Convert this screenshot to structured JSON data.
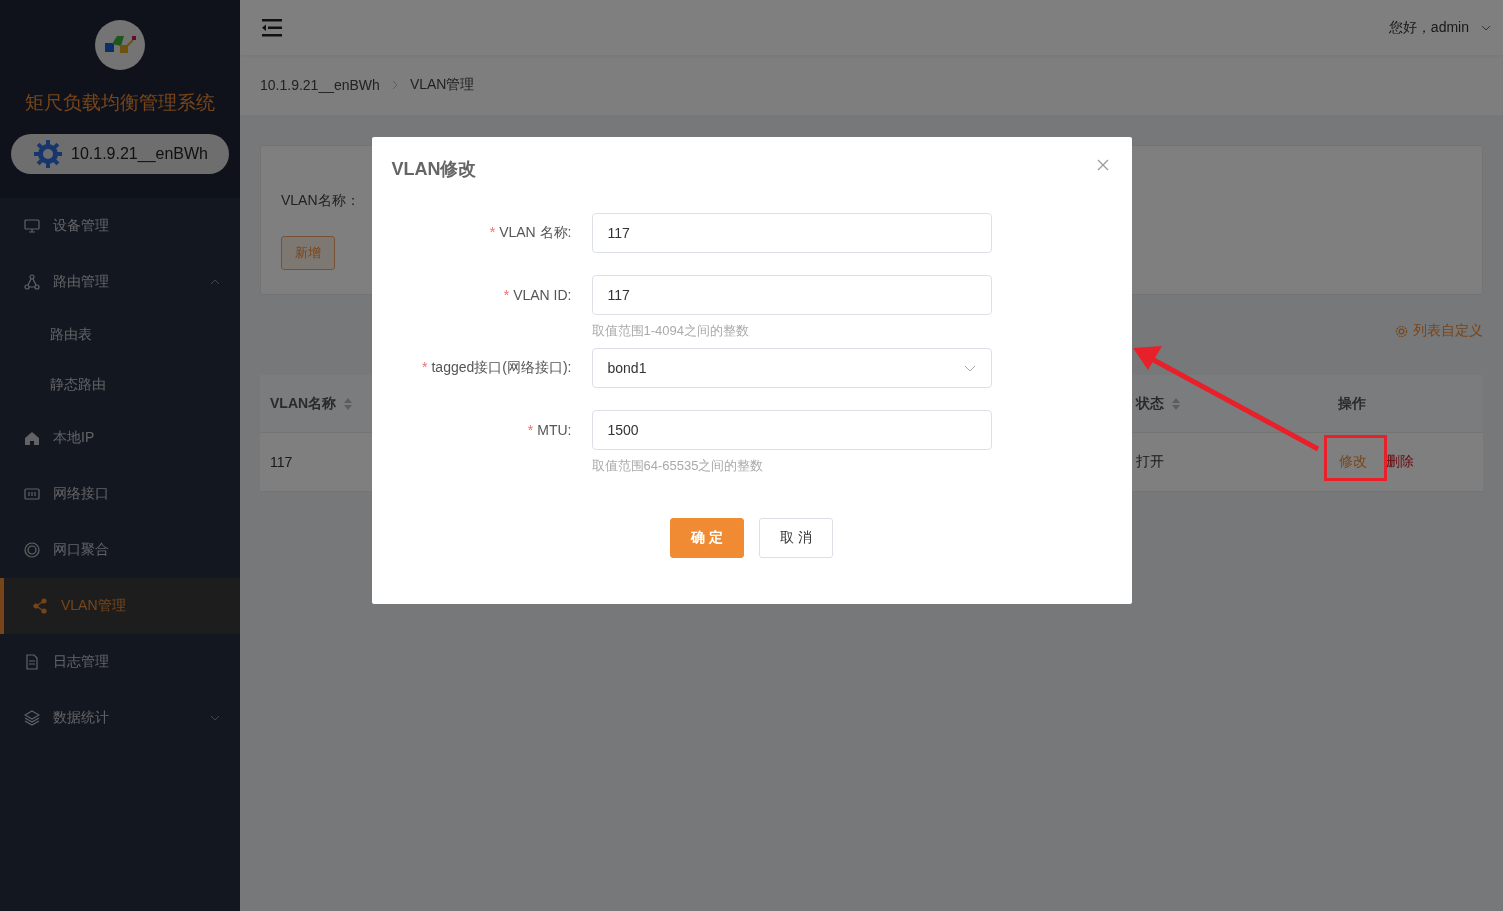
{
  "sidebar": {
    "title": "矩尺负载均衡管理系统",
    "device": "10.1.9.21__enBWh",
    "items": [
      {
        "label": "设备管理",
        "selected": false
      },
      {
        "label": "路由管理",
        "selected": false,
        "expanded": true,
        "children": [
          {
            "label": "路由表",
            "selected": false
          },
          {
            "label": "静态路由",
            "selected": false
          }
        ]
      },
      {
        "label": "本地IP",
        "selected": false
      },
      {
        "label": "网络接口",
        "selected": false
      },
      {
        "label": "网口聚合",
        "selected": false
      },
      {
        "label": "VLAN管理",
        "selected": true
      },
      {
        "label": "日志管理",
        "selected": false
      },
      {
        "label": "数据统计",
        "selected": false,
        "expanded": false
      }
    ]
  },
  "header": {
    "user": "您好，admin"
  },
  "breadcrumb": [
    "10.1.9.21__enBWh",
    "VLAN管理"
  ],
  "search": {
    "label": "VLAN名称：",
    "add_button": "新增"
  },
  "list_custom": "列表自定义",
  "table": {
    "columns": [
      {
        "label": "VLAN名称",
        "sortable": true
      },
      {
        "label": "状态",
        "sortable": true
      },
      {
        "label": "操作",
        "sortable": false
      }
    ],
    "rows": [
      {
        "cells": [
          "117",
          "打开"
        ],
        "actions": [
          {
            "label": "修改",
            "kind": "edit"
          },
          {
            "label": "删除",
            "kind": "delete"
          }
        ]
      }
    ]
  },
  "dialog": {
    "title": "VLAN修改",
    "fields": [
      {
        "required_mark": "*",
        "label": "VLAN 名称:",
        "kind": "input",
        "value": "117"
      },
      {
        "required_mark": "*",
        "label": "VLAN ID:",
        "kind": "input",
        "value": "117",
        "hint": "取值范围1-4094之间的整数"
      },
      {
        "required_mark": "*",
        "label": "tagged接口(网络接口):",
        "kind": "select",
        "value": "bond1"
      },
      {
        "required_mark": "*",
        "label": "MTU:",
        "kind": "input",
        "value": "1500",
        "hint": "取值范围64-65535之间的整数"
      }
    ],
    "buttons": [
      {
        "label": "确 定",
        "kind": "primary"
      },
      {
        "label": "取 消",
        "kind": "default"
      }
    ]
  }
}
